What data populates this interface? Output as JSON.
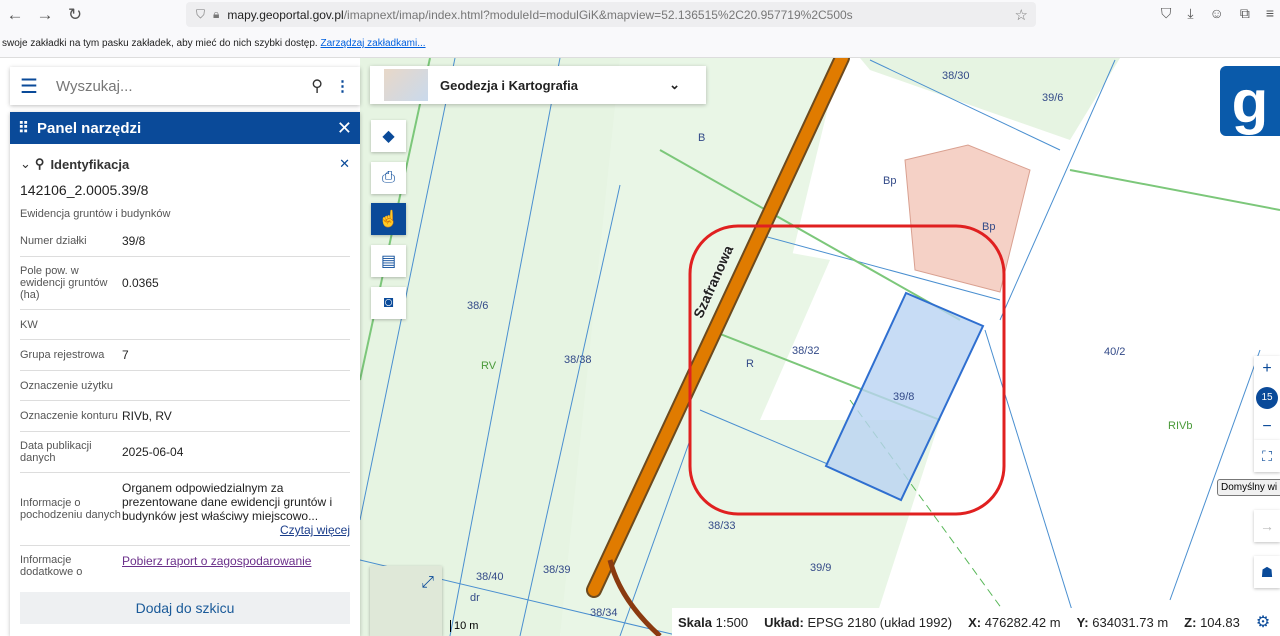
{
  "browser": {
    "url_domain": "mapy.geoportal.gov.pl",
    "url_rest": "/imapnext/imap/index.html?moduleId=modulGiK&mapview=52.136515%2C20.957719%2C500s",
    "bookmarks_text": "swoje zakładki na tym pasku zakładek, aby mieć do nich szybki dostęp.",
    "bookmarks_link": "Zarządzaj zakładkami..."
  },
  "search": {
    "placeholder": "Wyszukaj..."
  },
  "panel": {
    "title": "Panel narzędzi",
    "section": "Identyfikacja",
    "parcel_id": "142106_2.0005.39/8",
    "layer": "Ewidencja gruntów i budynków",
    "rows": [
      {
        "label": "Numer działki",
        "value": "39/8"
      },
      {
        "label": "Pole pow. w ewidencji gruntów (ha)",
        "value": "0.0365"
      },
      {
        "label": "KW",
        "value": ""
      },
      {
        "label": "Grupa rejestrowa",
        "value": "7"
      },
      {
        "label": "Oznaczenie użytku",
        "value": ""
      },
      {
        "label": "Oznaczenie konturu",
        "value": "RIVb, RV"
      },
      {
        "label": "Data publikacji danych",
        "value": "2025-06-04"
      },
      {
        "label": "Informacje o pochodzeniu danych",
        "value": "Organem odpowiedzialnym za prezentowane dane ewidencji gruntów i budynków jest właściwy miejscowo...",
        "more": "Czytaj więcej"
      },
      {
        "label": "Informacje dodatkowe o",
        "value": "Pobierz raport o zagospodarowanie"
      }
    ],
    "add_button": "Dodaj do szkicu"
  },
  "theme": {
    "label": "Geodezja i Kartografia"
  },
  "logo": "g",
  "zoom": {
    "level": "15",
    "tooltip": "Domyślny wi"
  },
  "map": {
    "street": "Szafranowa",
    "labels": [
      "B",
      "Bp",
      "Bp",
      "38/30",
      "39/6",
      "38/6",
      "RV",
      "38/38",
      "38/32",
      "R",
      "39/8",
      "40/2",
      "RIVb",
      "38/33",
      "39/9",
      "38/40",
      "38/39",
      "dr",
      "38/34"
    ],
    "scale_bar": "10 m"
  },
  "status": {
    "scale_label": "Skala",
    "scale": "1:500",
    "crs_label": "Układ:",
    "crs": "EPSG 2180 (układ 1992)",
    "x_label": "X:",
    "x": "476282.42 m",
    "y_label": "Y:",
    "y": "634031.73 m",
    "z_label": "Z:",
    "z": "104.83"
  },
  "colors": {
    "accent": "#0a4a99",
    "road": "#e07b00",
    "highlight": "#e02020"
  }
}
